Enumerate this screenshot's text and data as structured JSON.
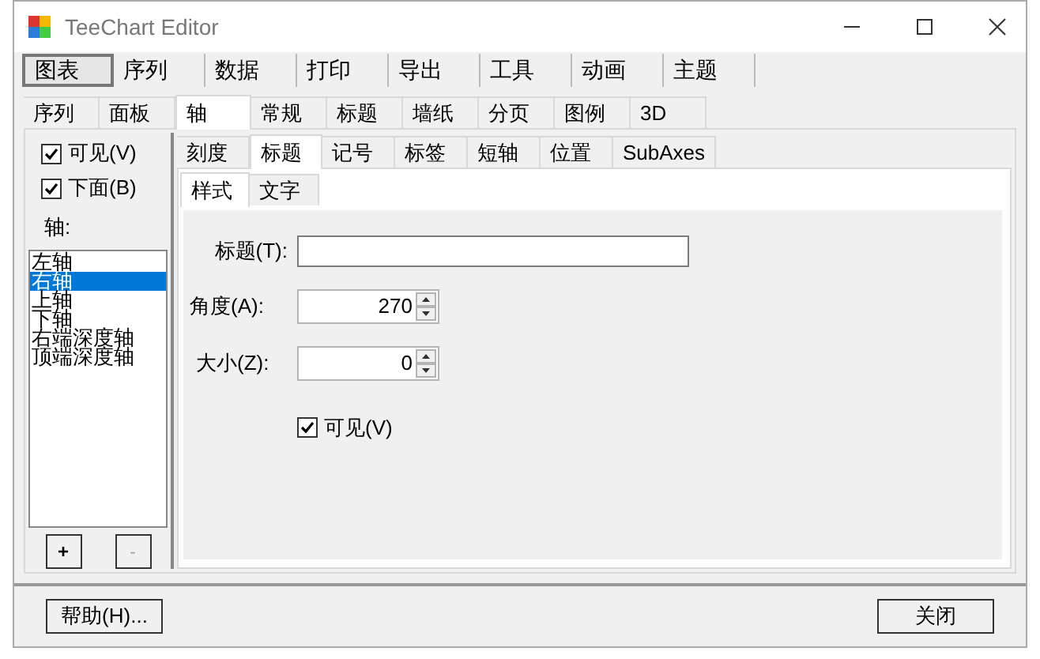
{
  "window": {
    "title": "TeeChart Editor"
  },
  "main_tabs": [
    {
      "label": "图表",
      "selected": true
    },
    {
      "label": "序列",
      "selected": false
    },
    {
      "label": "数据",
      "selected": false
    },
    {
      "label": "打印",
      "selected": false
    },
    {
      "label": "导出",
      "selected": false
    },
    {
      "label": "工具",
      "selected": false
    },
    {
      "label": "动画",
      "selected": false
    },
    {
      "label": "主题",
      "selected": false
    }
  ],
  "chart_tabs": [
    {
      "label": "序列",
      "selected": false
    },
    {
      "label": "面板",
      "selected": false
    },
    {
      "label": "轴",
      "selected": true
    },
    {
      "label": "常规",
      "selected": false
    },
    {
      "label": "标题",
      "selected": false
    },
    {
      "label": "墙纸",
      "selected": false
    },
    {
      "label": "分页",
      "selected": false
    },
    {
      "label": "图例",
      "selected": false
    },
    {
      "label": "3D",
      "selected": false
    }
  ],
  "axis_panel": {
    "checkboxes": [
      {
        "label": "可见(V)",
        "checked": true
      },
      {
        "label": "下面(B)",
        "checked": true
      }
    ],
    "list_label": "轴:",
    "axes": [
      {
        "label": "左轴",
        "selected": false
      },
      {
        "label": "右轴",
        "selected": true
      },
      {
        "label": "上轴",
        "selected": false
      },
      {
        "label": "下轴",
        "selected": false
      },
      {
        "label": "右端深度轴",
        "selected": false
      },
      {
        "label": "顶端深度轴",
        "selected": false
      }
    ],
    "buttons": [
      {
        "label": "+",
        "disabled": false
      },
      {
        "label": "-",
        "disabled": true
      }
    ]
  },
  "axis_tabs": [
    {
      "label": "刻度",
      "selected": false
    },
    {
      "label": "标题",
      "selected": true
    },
    {
      "label": "记号",
      "selected": false
    },
    {
      "label": "标签",
      "selected": false
    },
    {
      "label": "短轴",
      "selected": false
    },
    {
      "label": "位置",
      "selected": false
    },
    {
      "label": "SubAxes",
      "selected": false
    }
  ],
  "title_tabs": [
    {
      "label": "样式",
      "selected": true
    },
    {
      "label": "文字",
      "selected": false
    }
  ],
  "style": {
    "title_label": "标题(T):",
    "angle_label": "角度(A):",
    "angle_value": "270",
    "size_label": "大小(Z):",
    "size_value": "0",
    "visible": {
      "label": "可见(V)",
      "checked": true
    }
  },
  "footer": {
    "help": "帮助(H)...",
    "close": "关闭"
  }
}
